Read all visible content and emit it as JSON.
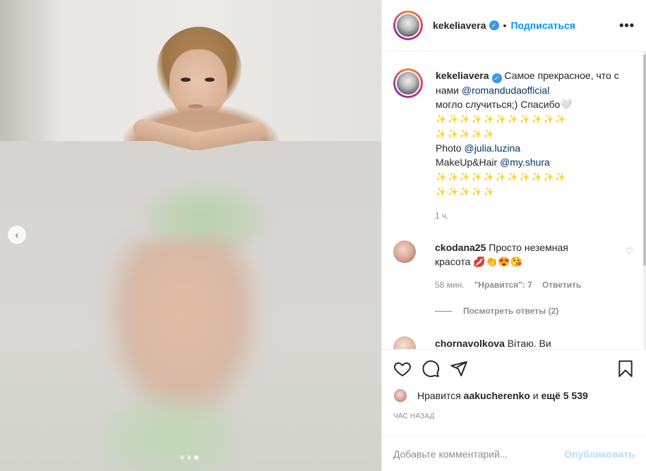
{
  "post": {
    "author": "kekeliavera",
    "follow_label": "Подписаться",
    "separator": "•",
    "more_label": "•••",
    "caption": {
      "text_1": "Самое прекрасное, что с нами",
      "mention_1": "@romandudaofficial",
      "text_2": "могло случиться;) Спасибо🤍",
      "stars_1": "✨✨✨✨✨✨✨✨✨✨✨",
      "stars_2": "✨✨✨✨✨",
      "photo_label": "Photo",
      "mention_2": "@julia.luzina",
      "makeup_label": "MakeUp&Hair",
      "mention_3": "@my.shura",
      "stars_3": "✨✨✨✨✨✨✨✨✨✨✨",
      "stars_4": "✨✨✨✨✨"
    },
    "time": "1 ч."
  },
  "comments": [
    {
      "user": "ckodana25",
      "text": "Просто неземная красота 💋👏😍😘",
      "time": "58 мин.",
      "likes": "\"Нравится\": 7",
      "reply_label": "Ответить",
      "view_replies": "Посмотреть ответы (2)"
    },
    {
      "user": "chornavolkova",
      "text": "Вітаю. Ви"
    }
  ],
  "footer": {
    "likes_prefix": "Нравится",
    "liked_by": "aakucherenko",
    "likes_and": "и",
    "likes_count": "ещё 5 539",
    "posted_ago": "ЧАС НАЗАД",
    "comment_placeholder": "Добавьте комментарий...",
    "publish_label": "Опубликовать"
  },
  "carousel": {
    "slide_count": 3,
    "active_index": 2
  },
  "colors": {
    "accent": "#0095f6",
    "verified": "#3897f0",
    "muted": "#8e8e8e",
    "text": "#262626",
    "publish_disabled": "#b2dffc"
  }
}
